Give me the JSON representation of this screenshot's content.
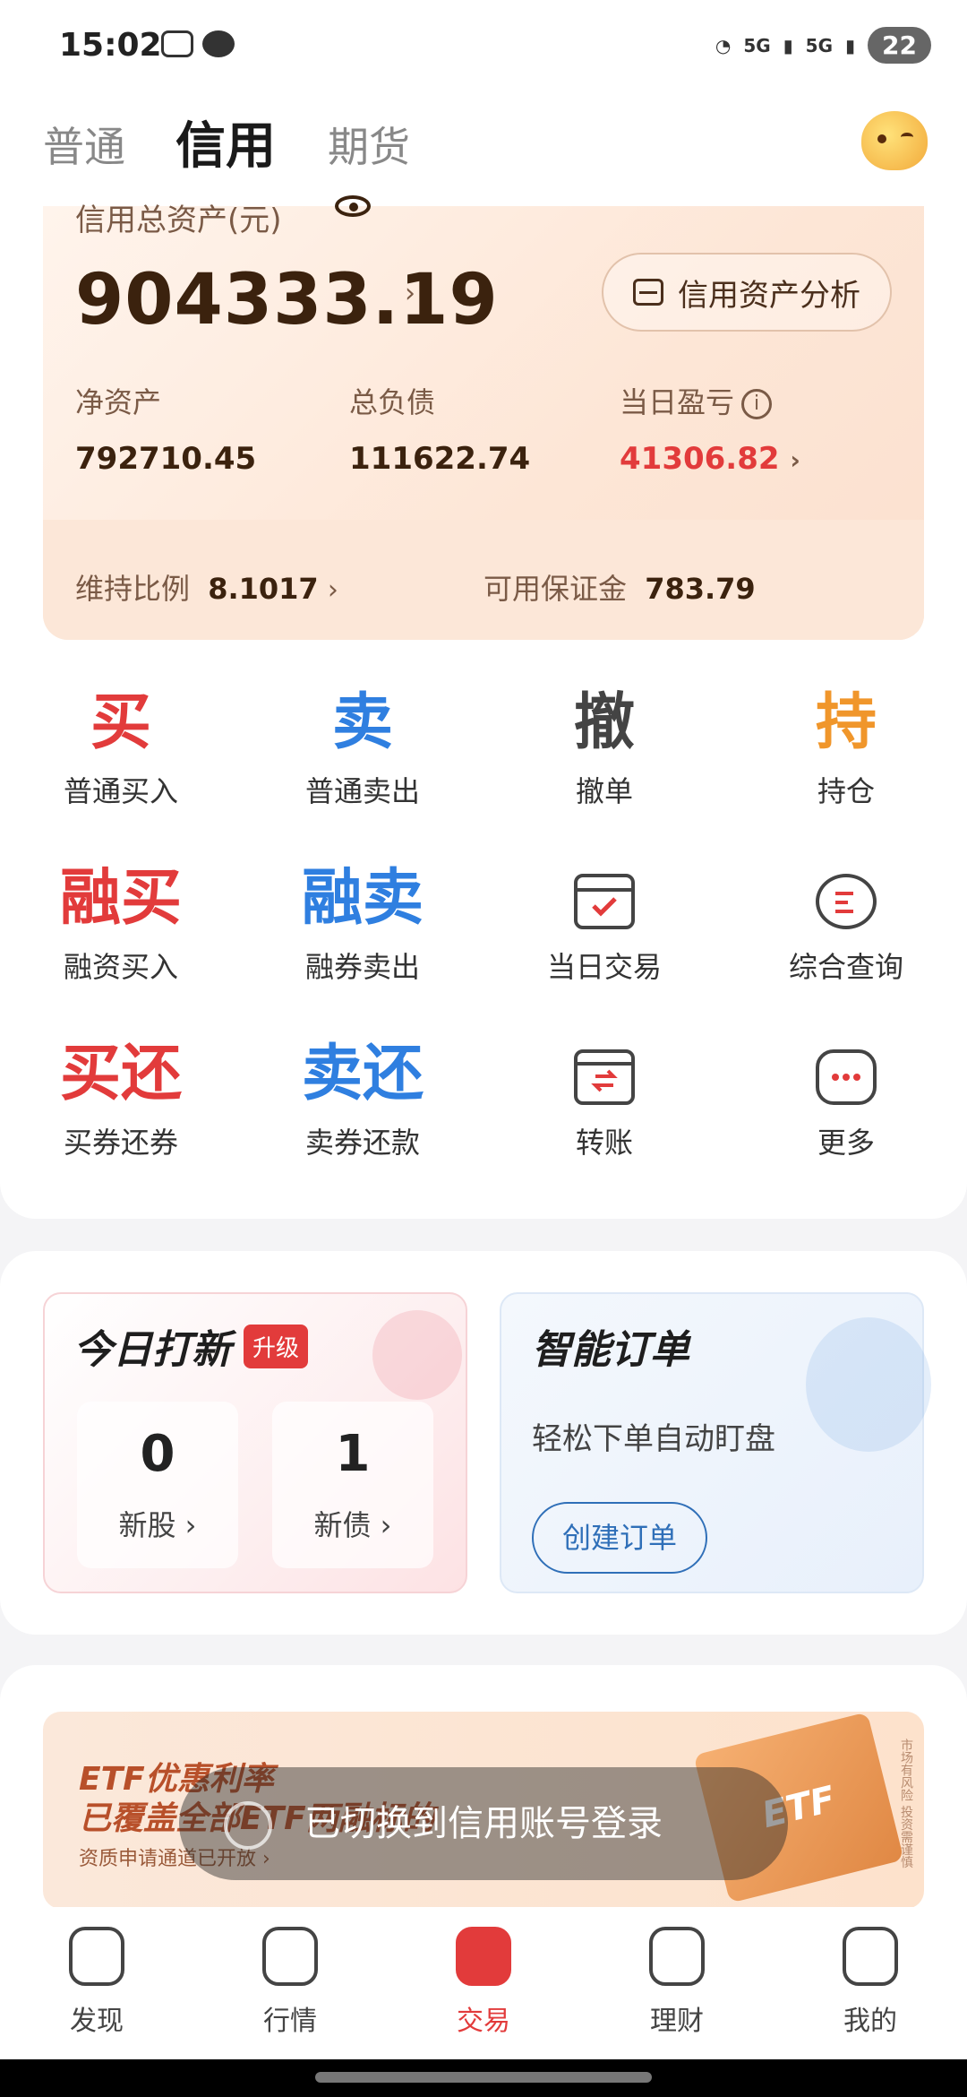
{
  "status_bar": {
    "time": "15:02",
    "signal1": "5G",
    "signal2": "5G",
    "battery": "22"
  },
  "tabs": [
    {
      "label": "普通",
      "active": false
    },
    {
      "label": "信用",
      "active": true
    },
    {
      "label": "期货",
      "active": false
    }
  ],
  "asset_card": {
    "total_label": "信用总资产(元)",
    "total_value": "904333.19",
    "analysis_button": "信用资产分析",
    "net_assets_label": "净资产",
    "net_assets_value": "792710.45",
    "total_debt_label": "总负债",
    "total_debt_value": "111622.74",
    "daily_pnl_label": "当日盈亏",
    "daily_pnl_value": "41306.82",
    "maintenance_label": "维持比例",
    "maintenance_value": "8.1017",
    "margin_label": "可用保证金",
    "margin_value": "783.79",
    "chevron": "›",
    "info_glyph": "i"
  },
  "grid": [
    {
      "glyph": "买",
      "label": "普通买入",
      "color": "#e23b3b"
    },
    {
      "glyph": "卖",
      "label": "普通卖出",
      "color": "#2f7fe0"
    },
    {
      "glyph": "撤",
      "label": "撤单",
      "color": "#444444"
    },
    {
      "glyph": "持",
      "label": "持仓",
      "color": "#f0962b"
    },
    {
      "glyph": "融买",
      "label": "融资买入",
      "color": "#e23b3b"
    },
    {
      "glyph": "融卖",
      "label": "融券卖出",
      "color": "#2f7fe0"
    },
    {
      "icon": "calendar-check-icon",
      "label": "当日交易"
    },
    {
      "icon": "search-doc-icon",
      "label": "综合查询"
    },
    {
      "glyph": "买还",
      "label": "买券还券",
      "color": "#e23b3b"
    },
    {
      "glyph": "卖还",
      "label": "卖券还款",
      "color": "#2f7fe0"
    },
    {
      "icon": "transfer-icon",
      "label": "转账"
    },
    {
      "icon": "more-icon",
      "label": "更多"
    }
  ],
  "ipo_card": {
    "title": "今日打新",
    "badge": "升级",
    "new_stocks_count": "0",
    "new_stocks_label": "新股 ›",
    "new_bonds_count": "1",
    "new_bonds_label": "新债 ›"
  },
  "smart_order_card": {
    "title": "智能订单",
    "subtitle": "轻松下单自动盯盘",
    "button": "创建订单"
  },
  "banner": {
    "line1": "ETF优惠利率",
    "line2": "已覆盖全部ETF两融标的",
    "line3": "资质申请通道已开放 ›",
    "box_text": "ETF",
    "side_note": "市场有风险 投资需谨慎"
  },
  "toast": "已切换到信用账号登录",
  "bottom_nav": [
    {
      "label": "发现",
      "icon": "compass-icon",
      "active": false
    },
    {
      "label": "行情",
      "icon": "trend-icon",
      "active": false
    },
    {
      "label": "交易",
      "icon": "trade-icon",
      "active": true
    },
    {
      "label": "理财",
      "icon": "wealth-icon",
      "active": false
    },
    {
      "label": "我的",
      "icon": "profile-icon",
      "active": false
    }
  ]
}
